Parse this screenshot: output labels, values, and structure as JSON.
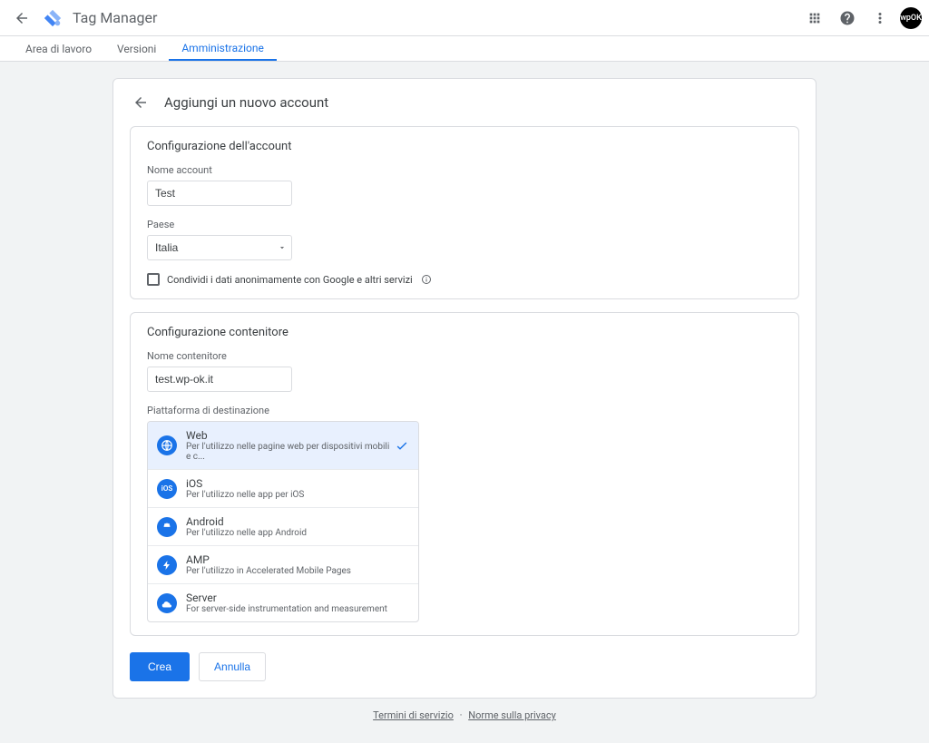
{
  "header": {
    "appTitle": "Tag Manager",
    "avatar": "wpOK"
  },
  "tabs": {
    "items": [
      {
        "label": "Area di lavoro",
        "active": false
      },
      {
        "label": "Versioni",
        "active": false
      },
      {
        "label": "Amministrazione",
        "active": true
      }
    ]
  },
  "page": {
    "title": "Aggiungi un nuovo account"
  },
  "accountSection": {
    "heading": "Configurazione dell'account",
    "nameLabel": "Nome account",
    "nameValue": "Test",
    "countryLabel": "Paese",
    "countryValue": "Italia",
    "shareLabel": "Condividi i dati anonimamente con Google e altri servizi"
  },
  "containerSection": {
    "heading": "Configurazione contenitore",
    "nameLabel": "Nome contenitore",
    "nameValue": "test.wp-ok.it",
    "platformLabel": "Piattaforma di destinazione",
    "platforms": [
      {
        "title": "Web",
        "desc": "Per l'utilizzo nelle pagine web per dispositivi mobili e c...",
        "selected": true
      },
      {
        "title": "iOS",
        "desc": "Per l'utilizzo nelle app per iOS",
        "selected": false
      },
      {
        "title": "Android",
        "desc": "Per l'utilizzo nelle app Android",
        "selected": false
      },
      {
        "title": "AMP",
        "desc": "Per l'utilizzo in Accelerated Mobile Pages",
        "selected": false
      },
      {
        "title": "Server",
        "desc": "For server-side instrumentation and measurement",
        "selected": false
      }
    ]
  },
  "buttons": {
    "primary": "Crea",
    "secondary": "Annulla"
  },
  "footer": {
    "terms": "Termini di servizio",
    "privacy": "Norme sulla privacy"
  }
}
